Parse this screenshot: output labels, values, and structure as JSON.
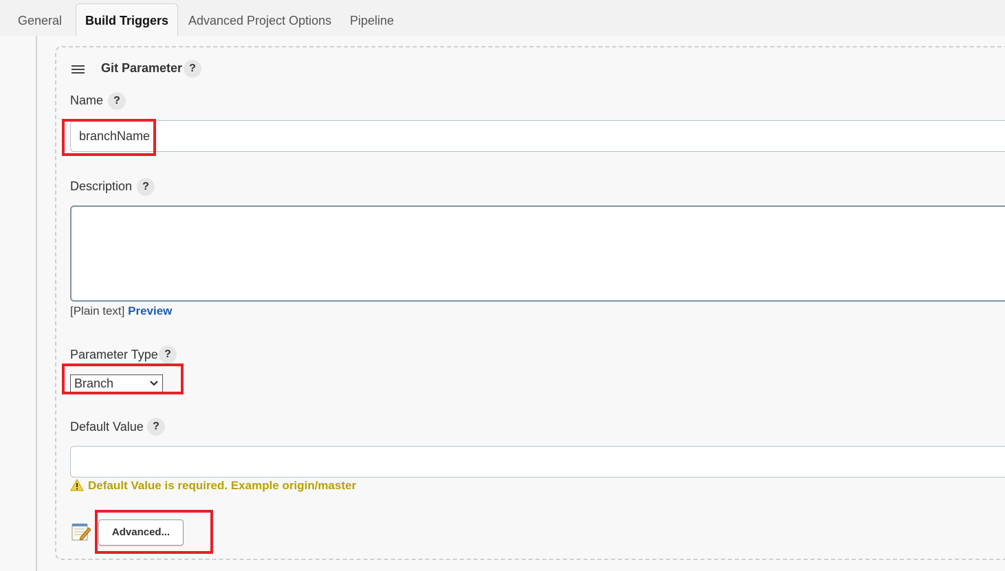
{
  "tabs": [
    {
      "label": "General",
      "active": false
    },
    {
      "label": "Build Triggers",
      "active": true
    },
    {
      "label": "Advanced Project Options",
      "active": false
    },
    {
      "label": "Pipeline",
      "active": false
    }
  ],
  "section": {
    "title": "Git Parameter",
    "help": "?",
    "name": {
      "label": "Name",
      "value": "branchName"
    },
    "description": {
      "label": "Description",
      "value": "",
      "format_prefix": "[Plain text]",
      "preview_link": "Preview"
    },
    "parameter_type": {
      "label": "Parameter Type",
      "selected": "Branch"
    },
    "default_value": {
      "label": "Default Value",
      "value": "",
      "warning": "Default Value is required. Example origin/master"
    },
    "advanced_button": "Advanced..."
  },
  "colors": {
    "highlight": "#e8202a",
    "warning": "#b8a200",
    "link": "#1a5fb4"
  }
}
